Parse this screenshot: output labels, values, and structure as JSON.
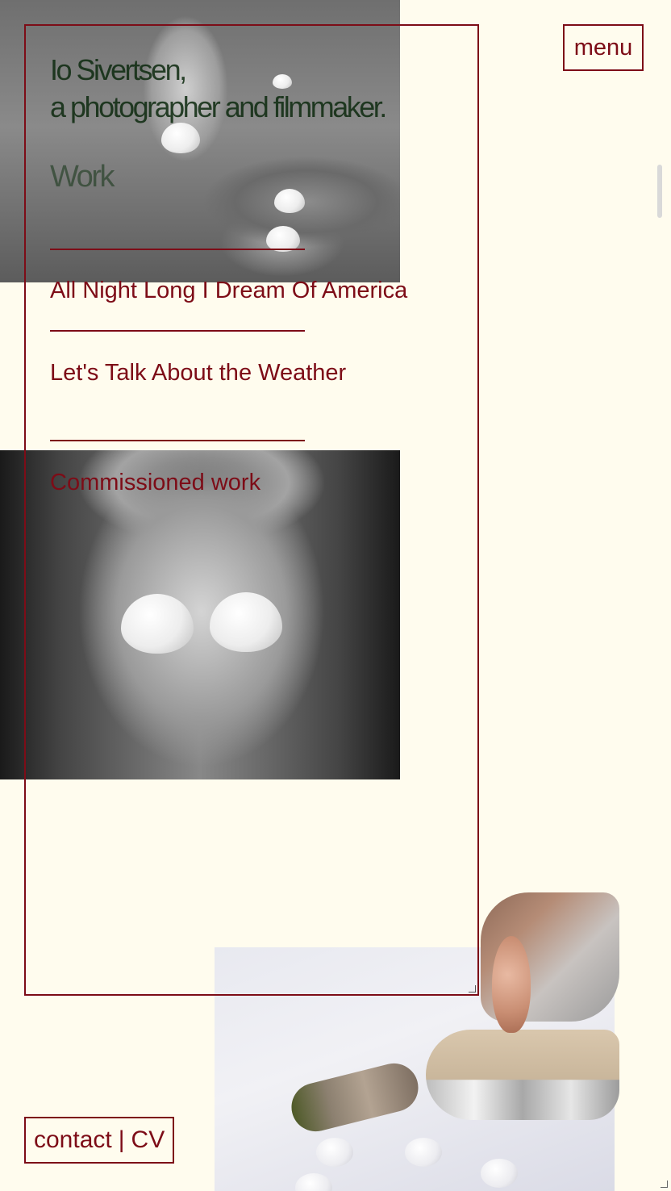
{
  "intro": {
    "line1": "Io Sivertsen,",
    "line2": "a photographer and filmmaker."
  },
  "work": {
    "heading": "Work",
    "projects": [
      {
        "label": "All Night Long I Dream Of America"
      },
      {
        "label": "Let's Talk About the Weather"
      },
      {
        "label": "Commissioned work"
      }
    ]
  },
  "nav": {
    "menu_label": "menu",
    "contact_label": "contact",
    "separator": "|",
    "cv_label": "CV"
  },
  "colors": {
    "background": "#fffcee",
    "accent": "#7d0c17",
    "heading_green": "#0d2a0f"
  },
  "images": [
    {
      "subject": "black-and-white photo of a seated nude figure holding eggs"
    },
    {
      "subject": "black-and-white portrait of a person holding eggs over their eyes"
    },
    {
      "subject": "color collage with eggs, a shell and a small figure on white fabric"
    }
  ]
}
